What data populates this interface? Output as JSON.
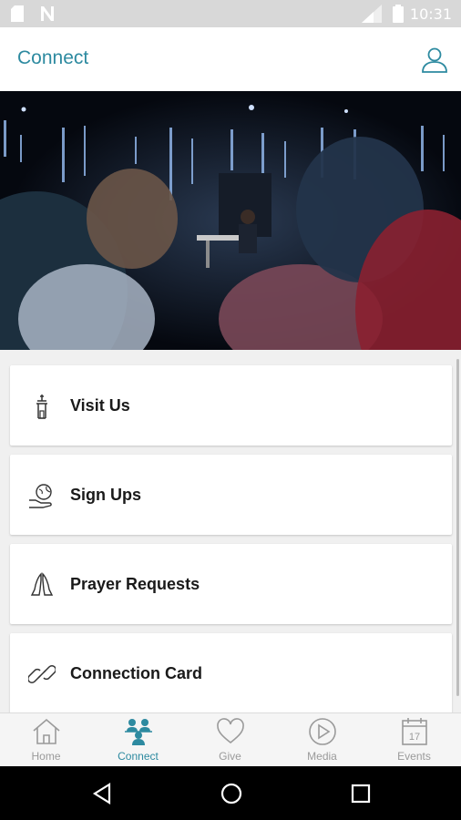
{
  "status": {
    "time": "10:31"
  },
  "header": {
    "title": "Connect"
  },
  "hero": {
    "image": "church-worship-stage-photo"
  },
  "menu": [
    {
      "label": "Visit Us",
      "icon": "building-icon"
    },
    {
      "label": "Sign Ups",
      "icon": "hand-globe-icon"
    },
    {
      "label": "Prayer Requests",
      "icon": "praying-hands-icon"
    },
    {
      "label": "Connection Card",
      "icon": "link-icon"
    }
  ],
  "tabs": [
    {
      "label": "Home",
      "icon": "home-icon",
      "active": false
    },
    {
      "label": "Connect",
      "icon": "people-icon",
      "active": true
    },
    {
      "label": "Give",
      "icon": "heart-icon",
      "active": false
    },
    {
      "label": "Media",
      "icon": "play-icon",
      "active": false
    },
    {
      "label": "Events",
      "icon": "calendar-icon",
      "active": false,
      "calendar_day": "17"
    }
  ],
  "colors": {
    "accent": "#2d8aa0",
    "inactive": "#9a9a9a"
  }
}
